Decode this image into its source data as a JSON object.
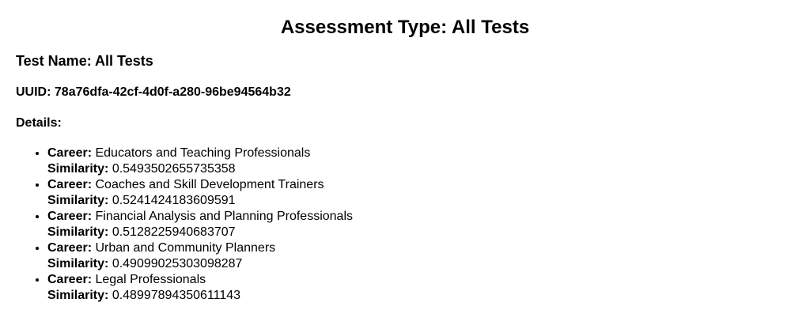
{
  "title_prefix": "Assessment Type: ",
  "assessment_type": "All Tests",
  "test_name_prefix": "Test Name: ",
  "test_name": "All Tests",
  "uuid_prefix": "UUID: ",
  "uuid": "78a76dfa-42cf-4d0f-a280-96be94564b32",
  "details_label": "Details:",
  "career_label": "Career:",
  "similarity_label": "Similarity:",
  "results": [
    {
      "career": "Educators and Teaching Professionals",
      "similarity": "0.5493502655735358"
    },
    {
      "career": "Coaches and Skill Development Trainers",
      "similarity": "0.5241424183609591"
    },
    {
      "career": "Financial Analysis and Planning Professionals",
      "similarity": "0.5128225940683707"
    },
    {
      "career": "Urban and Community Planners",
      "similarity": "0.49099025303098287"
    },
    {
      "career": "Legal Professionals",
      "similarity": "0.48997894350611143"
    }
  ]
}
